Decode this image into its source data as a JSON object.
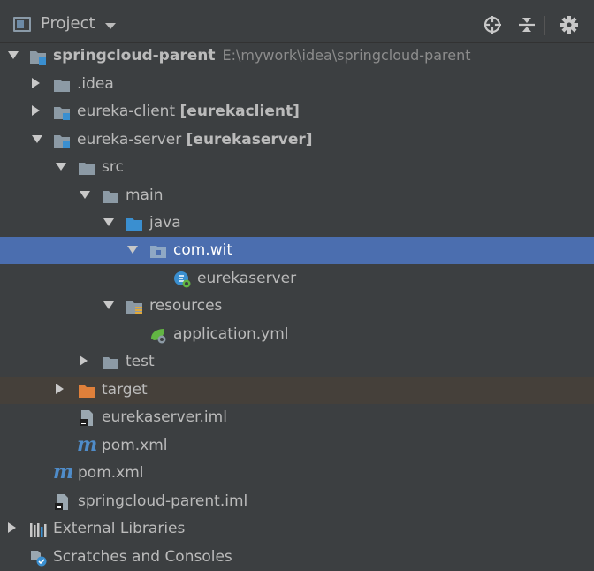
{
  "header": {
    "title": "Project",
    "icons": [
      "project-view-icon",
      "locate-icon",
      "collapse-all-icon",
      "settings-gear-icon"
    ]
  },
  "tree": {
    "root": {
      "name": "springcloud-parent",
      "path": "E:\\mywork\\idea\\springcloud-parent"
    },
    "idea": ".idea",
    "client": {
      "name": "eureka-client",
      "tag": "[eurekaclient]"
    },
    "server": {
      "name": "eureka-server",
      "tag": "[eurekaserver]"
    },
    "src": "src",
    "main": "main",
    "java": "java",
    "package": "com.wit",
    "app_class": "eurekaserver",
    "resources": "resources",
    "yml": "application.yml",
    "test": "test",
    "target": "target",
    "server_iml": "eurekaserver.iml",
    "server_pom": "pom.xml",
    "root_pom": "pom.xml",
    "root_iml": "springcloud-parent.iml",
    "ext_libs": "External Libraries",
    "scratches": "Scratches and Consoles"
  },
  "colors": {
    "background": "#3c3f41",
    "selection": "#4b6eaf",
    "excluded": "#45403a",
    "folder": "#8c9aa5",
    "source_folder": "#3a8fd0",
    "target_folder": "#e0803a"
  }
}
